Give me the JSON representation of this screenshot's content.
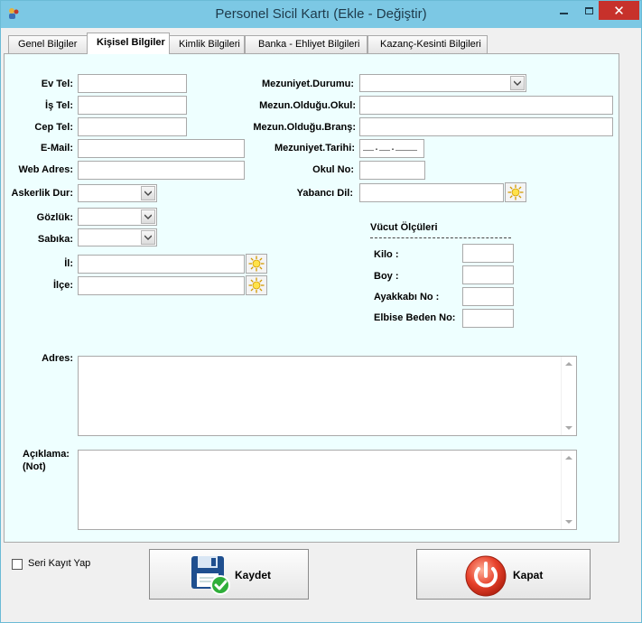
{
  "window": {
    "title": "Personel Sicil Kartı (Ekle - Değiştir)",
    "close_glyph": "✕"
  },
  "tabs": [
    {
      "label": "Genel Bilgiler"
    },
    {
      "label": "Kişisel Bilgiler",
      "active": true
    },
    {
      "label": "Kimlik Bilgileri"
    },
    {
      "label": "Banka - Ehliyet Bilgileri"
    },
    {
      "label": "Kazanç-Kesinti Bilgileri"
    }
  ],
  "form_left": {
    "ev_tel": "Ev Tel:",
    "is_tel": "İş Tel:",
    "cep_tel": "Cep Tel:",
    "email": "E-Mail:",
    "web_adres": "Web Adres:",
    "askerlik": "Askerlik Dur:",
    "gozluk": "Gözlük:",
    "sabika": "Sabıka:",
    "il": "İl:",
    "ilce": "İlçe:"
  },
  "form_right": {
    "mezuniyet_durumu": "Mezuniyet.Durumu:",
    "mezun_okul": "Mezun.Olduğu.Okul:",
    "mezun_brans": "Mezun.Olduğu.Branş:",
    "mezuniyet_tarihi": "Mezuniyet.Tarihi:",
    "mezuniyet_tarihi_mask": "__.__.____",
    "okul_no": "Okul No:",
    "yabanci_dil": "Yabancı Dil:"
  },
  "body_measures": {
    "title": "Vücut Ölçüleri",
    "kilo": "Kilo :",
    "boy": "Boy :",
    "ayakkabi": "Ayakkabı No :",
    "elbise": "Elbise Beden No:"
  },
  "notes": {
    "adres": "Adres:",
    "aciklama_1": "Açıklama:",
    "aciklama_2": "(Not)"
  },
  "footer": {
    "seri_kayit": "Seri Kayıt Yap",
    "save": "Kaydet",
    "close": "Kapat"
  },
  "icons": {
    "app": "app-icon",
    "save": "floppy-disk-check-icon",
    "close": "power-icon",
    "lookup": "sun-icon"
  }
}
